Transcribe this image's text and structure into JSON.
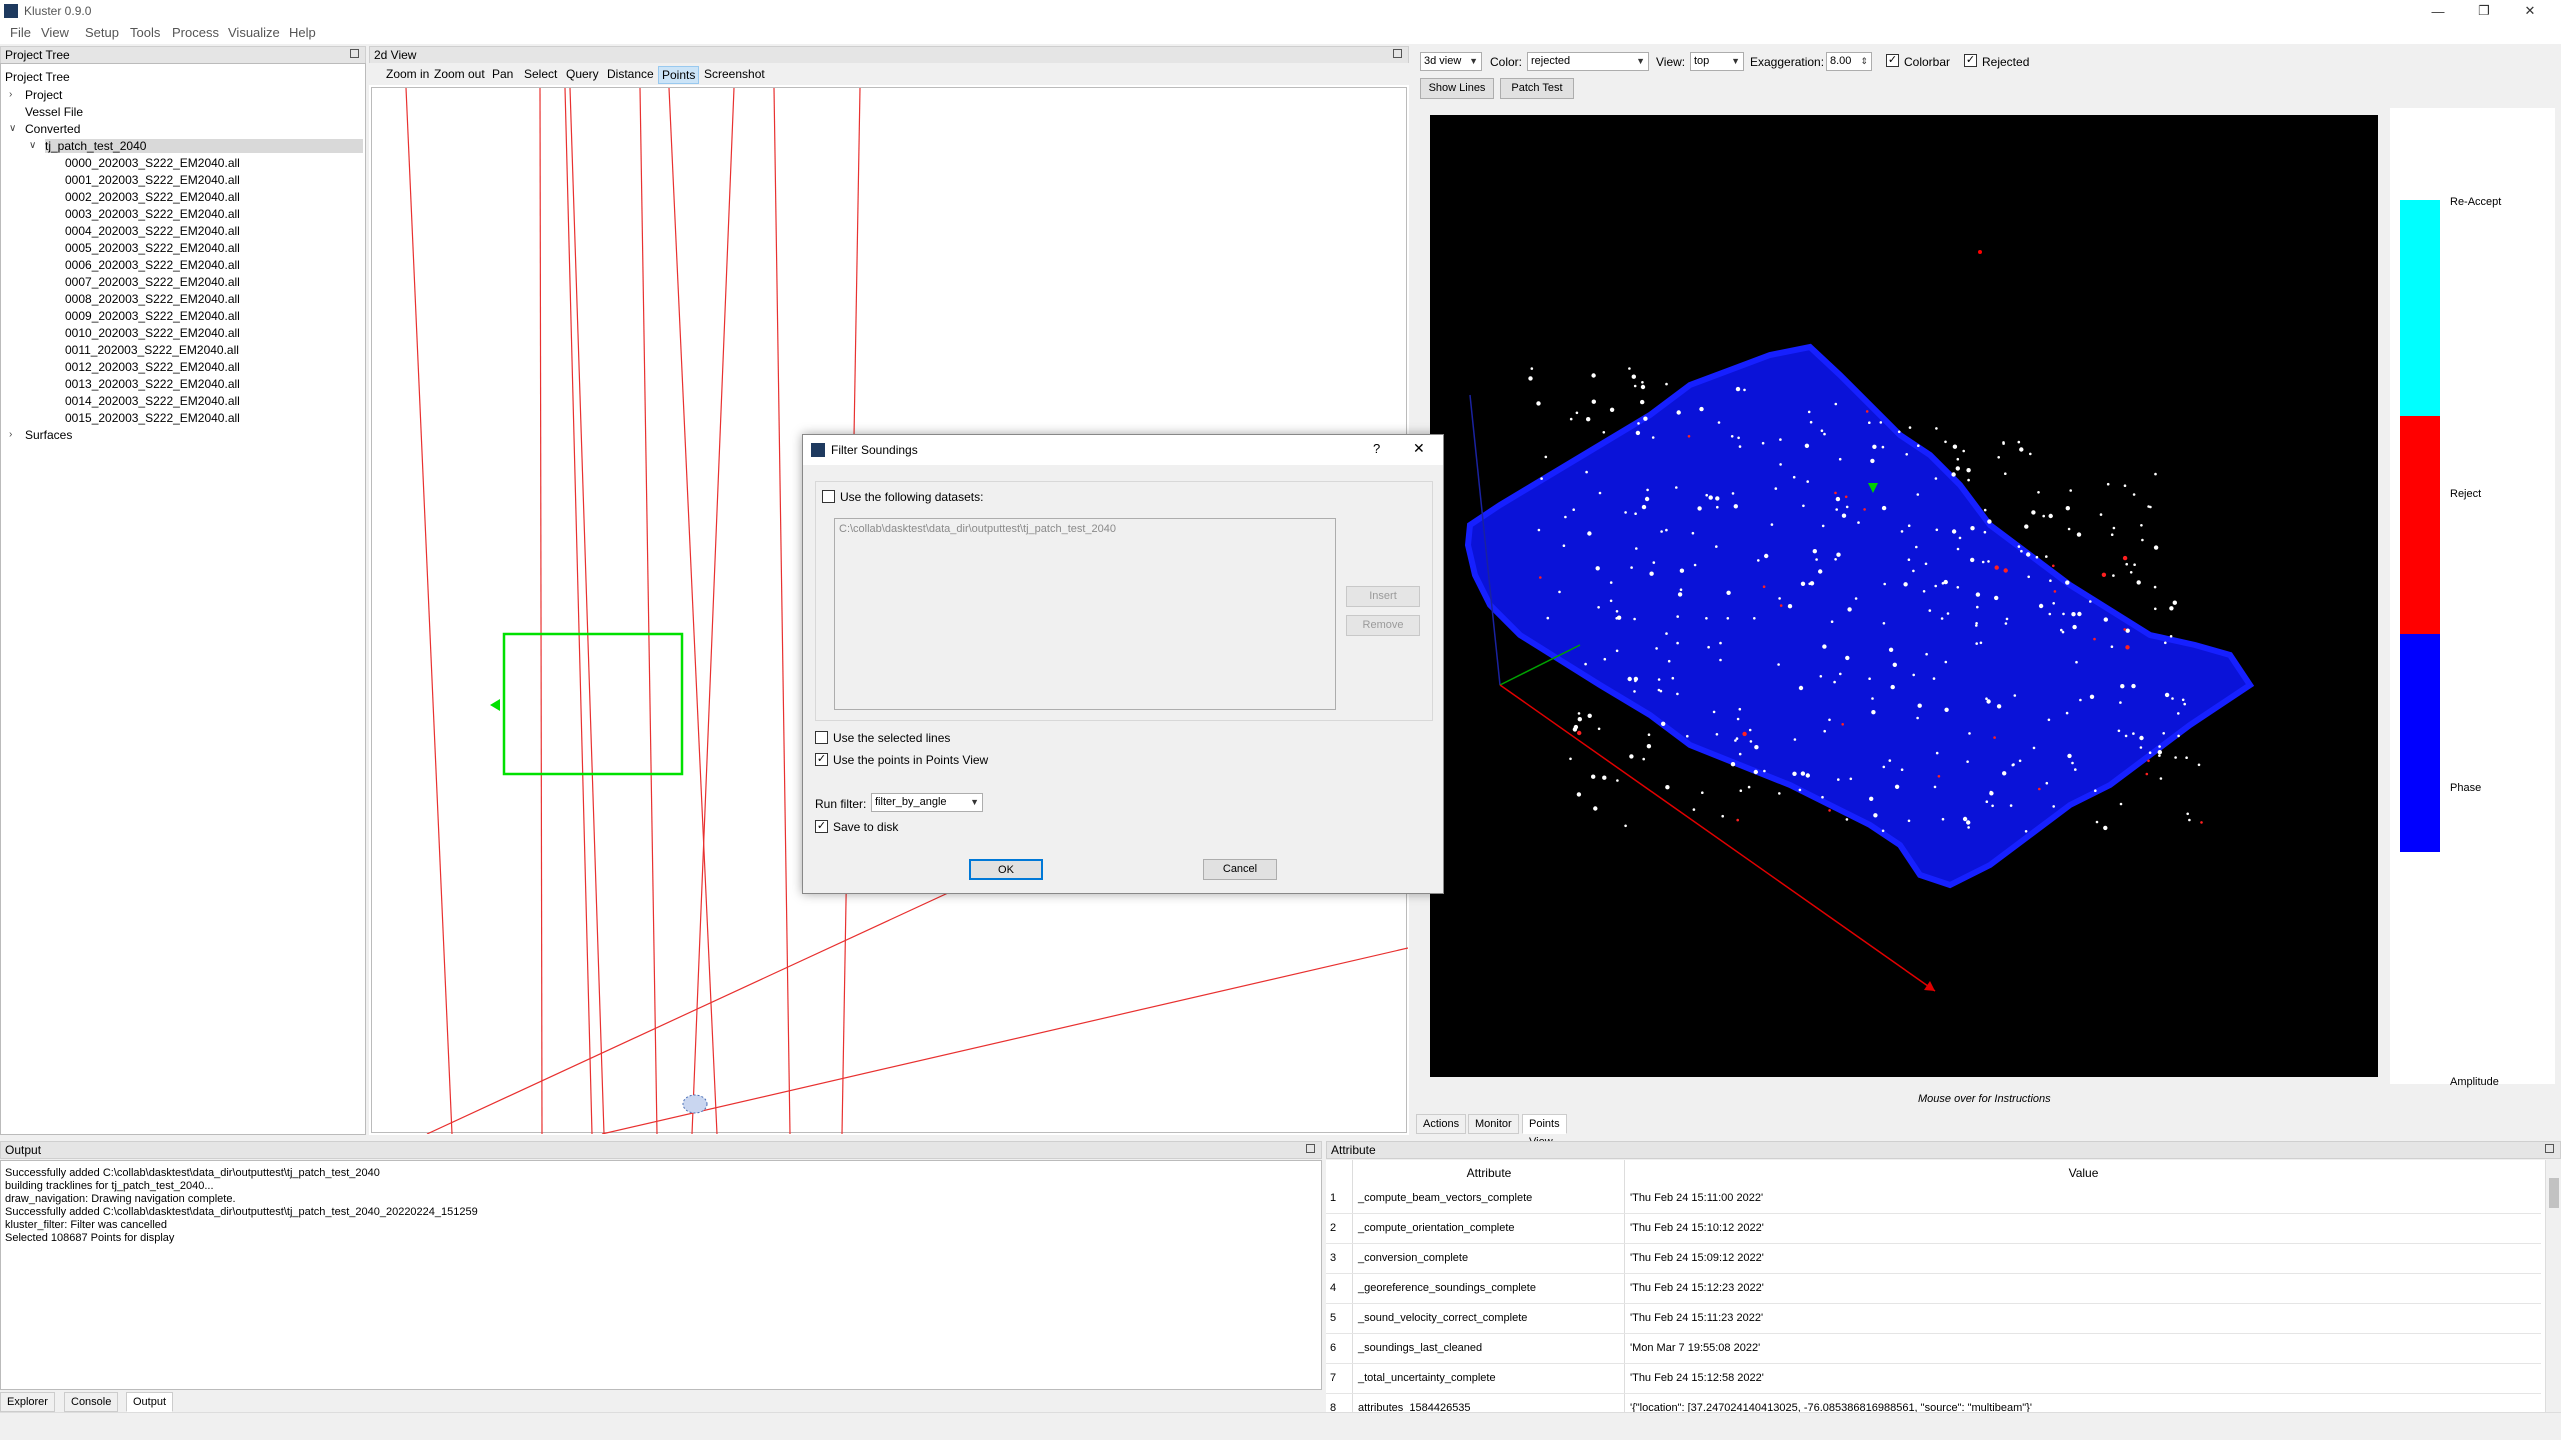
{
  "window": {
    "title": "Kluster 0.9.0",
    "minimize_icon": "minimize-icon",
    "maximize_icon": "restore-icon",
    "close_icon": "close-icon"
  },
  "menu": [
    "File",
    "View",
    "Setup",
    "Tools",
    "Process",
    "Visualize",
    "Help"
  ],
  "project_tree": {
    "dock_title": "Project Tree",
    "header": "Project Tree",
    "items": [
      {
        "label": "Project",
        "level": 0,
        "arrow": ">"
      },
      {
        "label": "Vessel File",
        "level": 0,
        "arrow": ""
      },
      {
        "label": "Converted",
        "level": 0,
        "arrow": "v"
      },
      {
        "label": "tj_patch_test_2040",
        "level": 1,
        "arrow": "v",
        "selected": true
      },
      {
        "label": "0000_202003_S222_EM2040.all",
        "level": 2,
        "arrow": ""
      },
      {
        "label": "0001_202003_S222_EM2040.all",
        "level": 2,
        "arrow": ""
      },
      {
        "label": "0002_202003_S222_EM2040.all",
        "level": 2,
        "arrow": ""
      },
      {
        "label": "0003_202003_S222_EM2040.all",
        "level": 2,
        "arrow": ""
      },
      {
        "label": "0004_202003_S222_EM2040.all",
        "level": 2,
        "arrow": ""
      },
      {
        "label": "0005_202003_S222_EM2040.all",
        "level": 2,
        "arrow": ""
      },
      {
        "label": "0006_202003_S222_EM2040.all",
        "level": 2,
        "arrow": ""
      },
      {
        "label": "0007_202003_S222_EM2040.all",
        "level": 2,
        "arrow": ""
      },
      {
        "label": "0008_202003_S222_EM2040.all",
        "level": 2,
        "arrow": ""
      },
      {
        "label": "0009_202003_S222_EM2040.all",
        "level": 2,
        "arrow": ""
      },
      {
        "label": "0010_202003_S222_EM2040.all",
        "level": 2,
        "arrow": ""
      },
      {
        "label": "0011_202003_S222_EM2040.all",
        "level": 2,
        "arrow": ""
      },
      {
        "label": "0012_202003_S222_EM2040.all",
        "level": 2,
        "arrow": ""
      },
      {
        "label": "0013_202003_S222_EM2040.all",
        "level": 2,
        "arrow": ""
      },
      {
        "label": "0014_202003_S222_EM2040.all",
        "level": 2,
        "arrow": ""
      },
      {
        "label": "0015_202003_S222_EM2040.all",
        "level": 2,
        "arrow": ""
      },
      {
        "label": "Surfaces",
        "level": 0,
        "arrow": ">"
      }
    ]
  },
  "view2d": {
    "dock_title": "2d View",
    "tools": [
      {
        "label": "Zoom in",
        "active": false
      },
      {
        "label": "Zoom out",
        "active": false
      },
      {
        "label": "Pan",
        "active": false
      },
      {
        "label": "Select",
        "active": false
      },
      {
        "label": "Query",
        "active": false
      },
      {
        "label": "Distance",
        "active": false
      },
      {
        "label": "Points",
        "active": true
      },
      {
        "label": "Screenshot",
        "active": false
      }
    ],
    "trackline_color": "#e8302f",
    "selection_box_color": "#00e000"
  },
  "view3d": {
    "view_mode": "3d view",
    "color_label": "Color:",
    "color_value": "rejected",
    "view_label": "View:",
    "view_value": "top",
    "exaggeration_label": "Exaggeration:",
    "exaggeration_value": "8.00",
    "colorbar_label": "Colorbar",
    "colorbar_checked": true,
    "rejected_label": "Rejected",
    "rejected_checked": true,
    "show_lines_button": "Show Lines",
    "patch_test_button": "Patch Test",
    "colorbar": [
      {
        "label": "Re-Accept",
        "color": "#00ffff"
      },
      {
        "label": "Reject",
        "color": "#ff0000"
      },
      {
        "label": "Phase",
        "color": "#0000ff"
      },
      {
        "label": "Amplitude",
        "color": "#ffffff"
      }
    ],
    "hint": "Mouse over for Instructions",
    "tabs": [
      {
        "label": "Actions",
        "active": false
      },
      {
        "label": "Monitor",
        "active": false
      },
      {
        "label": "Points View",
        "active": true
      }
    ]
  },
  "output": {
    "dock_title": "Output",
    "lines": [
      "Successfully added C:\\collab\\dasktest\\data_dir\\outputtest\\tj_patch_test_2040",
      "building tracklines for tj_patch_test_2040...",
      "draw_navigation: Drawing navigation complete.",
      "Successfully added C:\\collab\\dasktest\\data_dir\\outputtest\\tj_patch_test_2040_20220224_151259",
      "kluster_filter: Filter was cancelled",
      "Selected 108687 Points for display"
    ],
    "tabs": [
      {
        "label": "Explorer",
        "active": false
      },
      {
        "label": "Console",
        "active": false
      },
      {
        "label": "Output",
        "active": true
      }
    ]
  },
  "attribute": {
    "dock_title": "Attribute",
    "columns": [
      "Attribute",
      "Value"
    ],
    "rows": [
      {
        "idx": "1",
        "key": "_compute_beam_vectors_complete",
        "value": "'Thu Feb 24 15:11:00 2022'"
      },
      {
        "idx": "2",
        "key": "_compute_orientation_complete",
        "value": "'Thu Feb 24 15:10:12 2022'"
      },
      {
        "idx": "3",
        "key": "_conversion_complete",
        "value": "'Thu Feb 24 15:09:12 2022'"
      },
      {
        "idx": "4",
        "key": "_georeference_soundings_complete",
        "value": "'Thu Feb 24 15:12:23 2022'"
      },
      {
        "idx": "5",
        "key": "_sound_velocity_correct_complete",
        "value": "'Thu Feb 24 15:11:23 2022'"
      },
      {
        "idx": "6",
        "key": "_soundings_last_cleaned",
        "value": "'Mon Mar  7 19:55:08 2022'"
      },
      {
        "idx": "7",
        "key": "_total_uncertainty_complete",
        "value": "'Thu Feb 24 15:12:58 2022'"
      },
      {
        "idx": "8",
        "key": "attributes_1584426535",
        "value": "'{\"location\": [37.247024140413025, -76.085386816988561, \"source\": \"multibeam\"}'"
      }
    ]
  },
  "dialog": {
    "title": "Filter Soundings",
    "help": "?",
    "use_datasets_label": "Use the following datasets:",
    "use_datasets_checked": false,
    "dataset_path": "C:\\collab\\dasktest\\data_dir\\outputtest\\tj_patch_test_2040",
    "insert_button": "Insert",
    "remove_button": "Remove",
    "use_selected_lines_label": "Use the selected lines",
    "use_selected_lines_checked": false,
    "use_points_label": "Use the points in Points View",
    "use_points_checked": true,
    "run_filter_label": "Run filter:",
    "run_filter_value": "filter_by_angle",
    "save_to_disk_label": "Save to disk",
    "save_to_disk_checked": true,
    "ok_button": "OK",
    "cancel_button": "Cancel"
  }
}
